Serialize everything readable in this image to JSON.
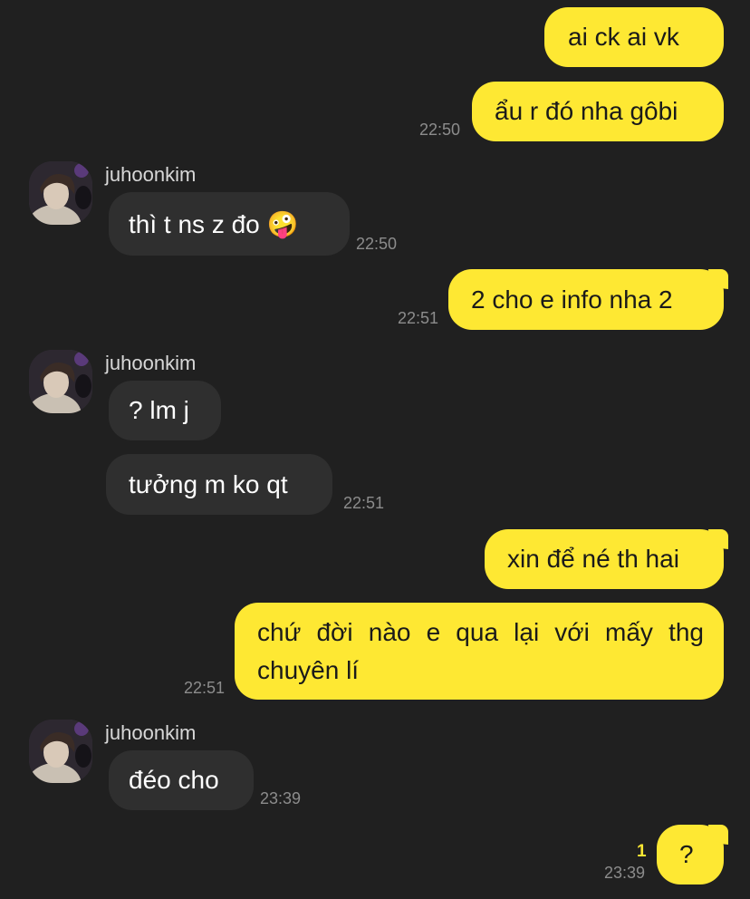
{
  "chat": {
    "contact_name": "juhoonkim",
    "messages": [
      {
        "dir": "out",
        "text": "ai ck ai vk",
        "time": ""
      },
      {
        "dir": "out",
        "text": "ẩu r đó nha gôbi",
        "time": "22:50"
      },
      {
        "dir": "in",
        "text": "thì t ns z đo 🤪",
        "time": "22:50"
      },
      {
        "dir": "out",
        "text": "2 cho e info nha 2",
        "time": "22:51"
      },
      {
        "dir": "in",
        "text": "? lm j",
        "time": ""
      },
      {
        "dir": "in",
        "text": "tưởng m ko qt",
        "time": "22:51"
      },
      {
        "dir": "out",
        "text": "xin để né th hai",
        "time": ""
      },
      {
        "dir": "out",
        "text": "chứ đời nào e qua lại với mấy thg chuyên lí",
        "time": "22:51"
      },
      {
        "dir": "in",
        "text": "đéo cho",
        "time": "23:39"
      },
      {
        "dir": "out",
        "text": "?",
        "time": "23:39",
        "unread": "1"
      }
    ]
  },
  "colors": {
    "background": "#202020",
    "outgoing_bubble": "#FEE833",
    "incoming_bubble": "#2F2F2F",
    "timestamp": "#8C8C8C",
    "unread_count": "#FEE833"
  },
  "icons": {
    "avatar": "profile-photo",
    "emoji": "zany-face-emoji"
  }
}
